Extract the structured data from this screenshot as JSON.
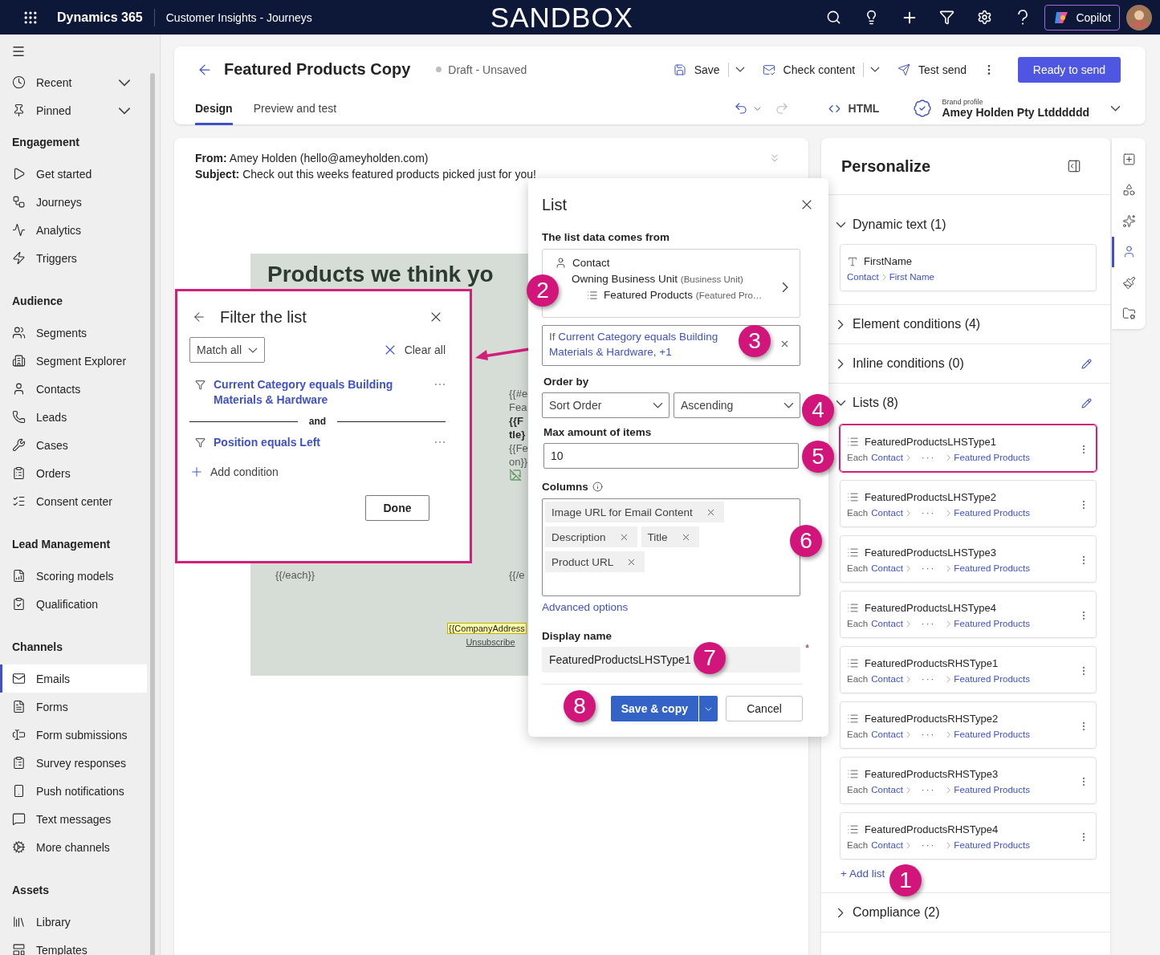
{
  "topbar": {
    "app_name": "Dynamics 365",
    "area": "Customer Insights - Journeys",
    "environment": "SANDBOX",
    "copilot": "Copilot"
  },
  "nav": {
    "pinned": [
      {
        "label": "Recent"
      },
      {
        "label": "Pinned"
      }
    ],
    "groups": [
      {
        "title": "Engagement",
        "items": [
          {
            "label": "Get started",
            "selected": false
          },
          {
            "label": "Journeys",
            "selected": false
          },
          {
            "label": "Analytics",
            "selected": false
          },
          {
            "label": "Triggers",
            "selected": false
          }
        ]
      },
      {
        "title": "Audience",
        "items": [
          {
            "label": "Segments",
            "selected": false
          },
          {
            "label": "Segment Explorer",
            "selected": false
          },
          {
            "label": "Contacts",
            "selected": false
          },
          {
            "label": "Leads",
            "selected": false
          },
          {
            "label": "Cases",
            "selected": false
          },
          {
            "label": "Orders",
            "selected": false
          },
          {
            "label": "Consent center",
            "selected": false
          }
        ]
      },
      {
        "title": "Lead Management",
        "items": [
          {
            "label": "Scoring models",
            "selected": false
          },
          {
            "label": "Qualification",
            "selected": false
          }
        ]
      },
      {
        "title": "Channels",
        "items": [
          {
            "label": "Emails",
            "selected": true
          },
          {
            "label": "Forms",
            "selected": false
          },
          {
            "label": "Form submissions",
            "selected": false
          },
          {
            "label": "Survey responses",
            "selected": false
          },
          {
            "label": "Push notifications",
            "selected": false
          },
          {
            "label": "Text messages",
            "selected": false
          },
          {
            "label": "More channels",
            "selected": false
          }
        ]
      },
      {
        "title": "Assets",
        "items": [
          {
            "label": "Library",
            "selected": false
          },
          {
            "label": "Templates",
            "selected": false
          }
        ]
      }
    ]
  },
  "editor": {
    "title": "Featured Products Copy",
    "status": "Draft - Unsaved",
    "actions": [
      {
        "label": "Save",
        "kind": "split"
      },
      {
        "label": "Check content",
        "kind": "split"
      },
      {
        "label": "Test send",
        "kind": "plain"
      }
    ],
    "primary": "Ready to send",
    "tabs": [
      {
        "label": "Design",
        "selected": true
      },
      {
        "label": "Preview and test",
        "selected": false
      }
    ],
    "html": "HTML",
    "brand_caption": "Brand profile",
    "brand_name": "Amey Holden Pty Ltdddddd"
  },
  "email": {
    "from_label": "From:",
    "from": "Amey Holden (hello@ameyholden.com)",
    "subject_label": "Subject:",
    "subject": "Check out this weeks featured products picked just for you!",
    "heading": "Products we think yo",
    "fragments": [
      {
        "text": "{{#e",
        "bold": false
      },
      {
        "text": "Fea",
        "bold": false
      },
      {
        "text": "{{F",
        "bold": true
      },
      {
        "text": "tle}",
        "bold": true
      },
      {
        "text": "{{Fe",
        "bold": false
      },
      {
        "text": "on}}",
        "bold": false
      }
    ],
    "left_end": "{{/each}}",
    "right_end": "{{/e",
    "company_address": "{{CompanyAddress",
    "unsubscribe": "Unsubscribe"
  },
  "personalize": {
    "title": "Personalize",
    "sections": [
      {
        "kind": "dynamic",
        "title": "Dynamic text (1)",
        "expanded": true,
        "editable": false,
        "items": [
          {
            "name": "FirstName",
            "path": [
              "Contact",
              "First Name"
            ]
          }
        ]
      },
      {
        "title": "Element conditions (4)",
        "expanded": false,
        "editable": false
      },
      {
        "title": "Inline conditions (0)",
        "expanded": false,
        "editable": true
      },
      {
        "kind": "lists",
        "title": "Lists (8)",
        "expanded": true,
        "editable": true,
        "add_label": "+ Add list",
        "items": [
          {
            "name": "FeaturedProductsLHSType1",
            "each": "Each",
            "source": "Contact",
            "middle": "···",
            "target": "Featured Products",
            "highlighted": true
          },
          {
            "name": "FeaturedProductsLHSType2",
            "each": "Each",
            "source": "Contact",
            "middle": "···",
            "target": "Featured Products",
            "highlighted": false
          },
          {
            "name": "FeaturedProductsLHSType3",
            "each": "Each",
            "source": "Contact",
            "middle": "···",
            "target": "Featured Products",
            "highlighted": false
          },
          {
            "name": "FeaturedProductsLHSType4",
            "each": "Each",
            "source": "Contact",
            "middle": "···",
            "target": "Featured Products",
            "highlighted": false
          },
          {
            "name": "FeaturedProductsRHSType1",
            "each": "Each",
            "source": "Contact",
            "middle": "···",
            "target": "Featured Products",
            "highlighted": false
          },
          {
            "name": "FeaturedProductsRHSType2",
            "each": "Each",
            "source": "Contact",
            "middle": "···",
            "target": "Featured Products",
            "highlighted": false
          },
          {
            "name": "FeaturedProductsRHSType3",
            "each": "Each",
            "source": "Contact",
            "middle": "···",
            "target": "Featured Products",
            "highlighted": false
          },
          {
            "name": "FeaturedProductsRHSType4",
            "each": "Each",
            "source": "Contact",
            "middle": "···",
            "target": "Featured Products",
            "highlighted": false
          }
        ]
      },
      {
        "title": "Compliance (2)",
        "expanded": false,
        "editable": false
      }
    ]
  },
  "rail": [
    {
      "selected": false
    },
    {
      "selected": false
    },
    {
      "selected": false
    },
    {
      "selected": true
    },
    {
      "selected": false
    },
    {
      "selected": false
    }
  ],
  "list_dialog": {
    "title": "List",
    "source_label": "The list data comes from",
    "source_root": "Contact",
    "source_steps": [
      {
        "name": "Owning Business Unit",
        "type": "(Business Unit)"
      },
      {
        "name": "Featured Products",
        "type": "(Featured Pro…"
      }
    ],
    "filter_prefix": "If",
    "filter_text": "Current Category equals Building Materials & Hardware, +1",
    "order_label": "Order by",
    "order_field": "Sort Order",
    "order_direction": "Ascending",
    "max_label": "Max amount of items",
    "max_value": "10",
    "columns_label": "Columns",
    "columns": [
      "Image URL for Email Content",
      "Description",
      "Title",
      "Product URL"
    ],
    "advanced": "Advanced options",
    "display_label": "Display name",
    "display_value": "FeaturedProductsLHSType1",
    "required_mark": "*",
    "save": "Save & copy",
    "cancel": "Cancel"
  },
  "filter_panel": {
    "title": "Filter the list",
    "match": "Match all",
    "clear": "Clear all",
    "conditions": [
      "Current Category equals Building Materials & Hardware",
      "Position equals Left"
    ],
    "joiner": "and",
    "add": "Add condition",
    "done": "Done"
  },
  "callouts": [
    "1",
    "2",
    "3",
    "4",
    "5",
    "6",
    "7",
    "8"
  ]
}
